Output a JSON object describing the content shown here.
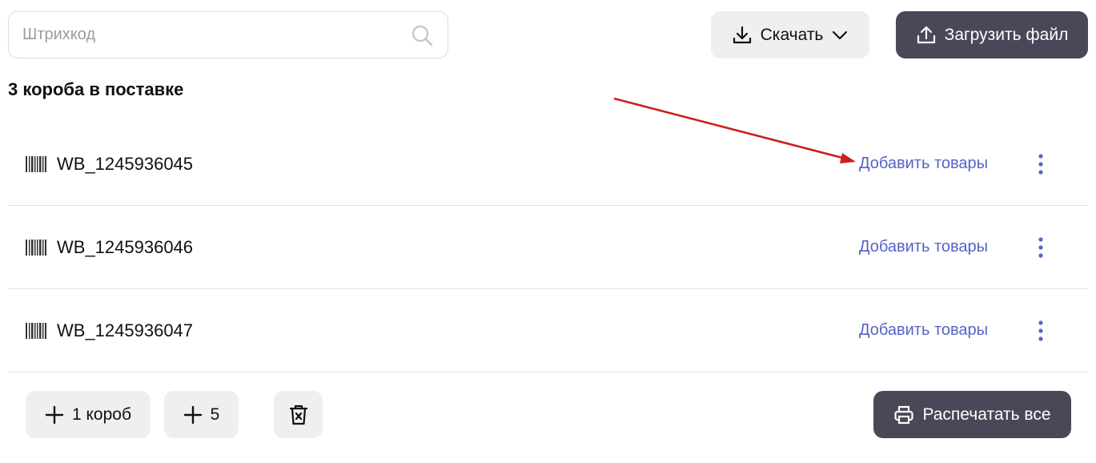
{
  "search": {
    "placeholder": "Штрихкод",
    "value": "",
    "icon": "search-icon"
  },
  "toolbar": {
    "download_label": "Скачать",
    "upload_label": "Загрузить файл"
  },
  "summary": {
    "heading": "3 короба в поставке"
  },
  "boxes": [
    {
      "code": "WB_1245936045",
      "action": "Добавить товары"
    },
    {
      "code": "WB_1245936046",
      "action": "Добавить товары"
    },
    {
      "code": "WB_1245936047",
      "action": "Добавить товары"
    }
  ],
  "footer": {
    "add_box_label": "1 короб",
    "add_five_label": "5",
    "print_all_label": "Распечатать все"
  },
  "colors": {
    "accent_link": "#5663c4",
    "dark_button": "#4a4858",
    "light_button": "#efefef",
    "annotation_arrow": "#cc1f1f"
  }
}
